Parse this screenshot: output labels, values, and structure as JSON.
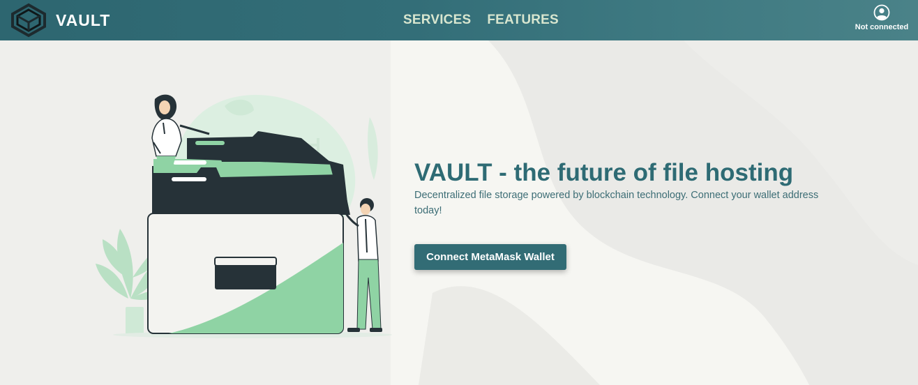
{
  "header": {
    "brand": "VAULT",
    "nav": [
      {
        "label": "SERVICES"
      },
      {
        "label": "FEATURES"
      }
    ],
    "account_status": "Not connected"
  },
  "hero": {
    "title": "VAULT - the future of file hosting",
    "subtitle": "Decentralized file storage powered by blockchain technology. Connect your wallet address today!",
    "cta_label": "Connect MetaMask Wallet"
  },
  "colors": {
    "primary": "#326c75",
    "accent_green": "#8fd3a4",
    "dark": "#263238",
    "nav_link": "#d8e6cf"
  },
  "icons": {
    "logo": "hexagon-chain-logo",
    "account": "user-circle-icon"
  },
  "illustration": "people-with-folders-illustration"
}
